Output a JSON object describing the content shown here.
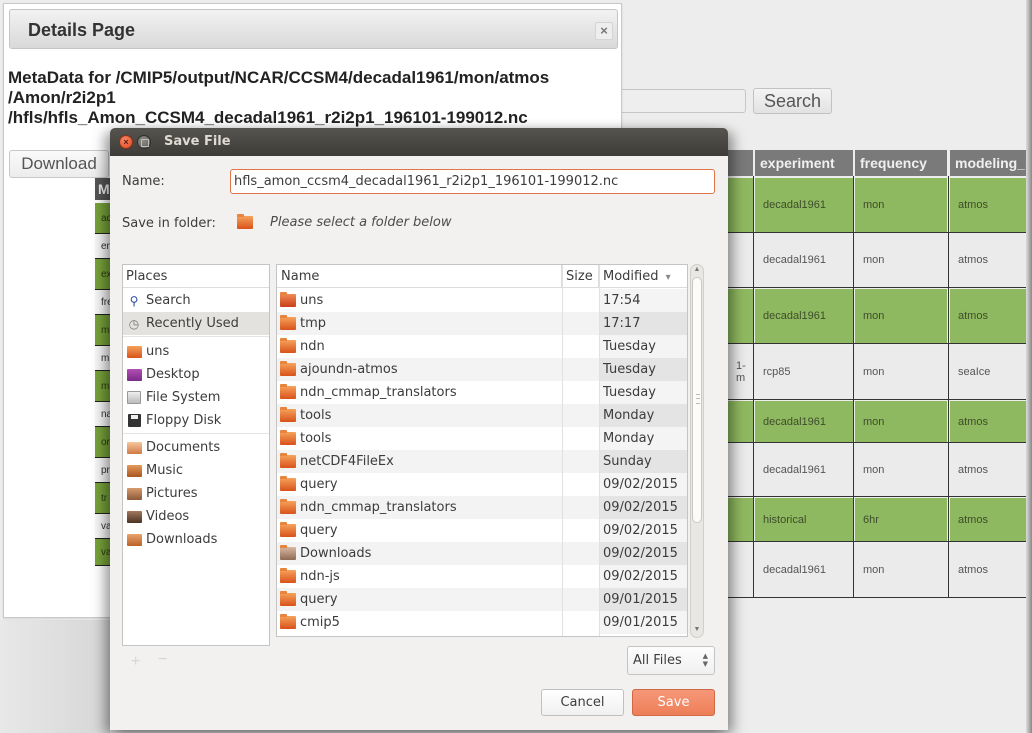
{
  "background_page": {
    "search": {
      "value": "",
      "button_label": "Search"
    },
    "results_table": {
      "columns": [
        "experiment",
        "frequency",
        "modeling_r"
      ],
      "rows": [
        {
          "cut_prefix": "",
          "experiment": "decadal1961",
          "frequency": "mon",
          "modeling_realm": "atmos",
          "highlight": true
        },
        {
          "cut_prefix": "",
          "experiment": "decadal1961",
          "frequency": "mon",
          "modeling_realm": "atmos",
          "highlight": false
        },
        {
          "cut_prefix": "",
          "experiment": "decadal1961",
          "frequency": "mon",
          "modeling_realm": "atmos",
          "highlight": true
        },
        {
          "cut_prefix": "1-m",
          "experiment": "rcp85",
          "frequency": "mon",
          "modeling_realm": "seaIce",
          "highlight": false
        },
        {
          "cut_prefix": "",
          "experiment": "decadal1961",
          "frequency": "mon",
          "modeling_realm": "atmos",
          "highlight": true
        },
        {
          "cut_prefix": "",
          "experiment": "decadal1961",
          "frequency": "mon",
          "modeling_realm": "atmos",
          "highlight": false
        },
        {
          "cut_prefix": "",
          "experiment": "historical",
          "frequency": "6hr",
          "modeling_realm": "atmos",
          "highlight": true
        },
        {
          "cut_prefix": "",
          "experiment": "decadal1961",
          "frequency": "mon",
          "modeling_realm": "atmos",
          "highlight": false
        }
      ]
    }
  },
  "details_page": {
    "title": "Details Page",
    "close_label": "×",
    "metadata_heading": "MetaData for /CMIP5/output/NCAR/CCSM4/decadal1961/mon/atmos /Amon/r2i2p1 /hfls/hfls_Amon_CCSM4_decadal1961_r2i2p1_196101-199012.nc",
    "metadata_lines": [
      "MetaData for /CMIP5/output/NCAR/CCSM4/decadal1961/mon/atmos",
      "/Amon/r2i2p1",
      "/hfls/hfls_Amon_CCSM4_decadal1961_r2i2p1_196101-199012.nc"
    ],
    "download_label": "Download",
    "side_table": {
      "header": "M",
      "cells": [
        "ac",
        "en",
        "ex",
        "fre",
        "m",
        "m",
        "m",
        "na",
        "or",
        "pr",
        "tr",
        "va",
        "va"
      ]
    }
  },
  "save_dialog": {
    "title": "Save File",
    "name_label": "Name:",
    "name_value": "hfls_amon_ccsm4_decadal1961_r2i2p1_196101-199012.nc",
    "folder_label": "Save in folder:",
    "folder_hint": "Please select a folder below",
    "places": {
      "header": "Places",
      "items": [
        {
          "label": "Search",
          "icon": "search-icon",
          "selected": false
        },
        {
          "label": "Recently Used",
          "icon": "clock-icon",
          "selected": true
        },
        {
          "label": "uns",
          "icon": "home-folder-icon",
          "selected": false
        },
        {
          "label": "Desktop",
          "icon": "desktop-icon",
          "selected": false
        },
        {
          "label": "File System",
          "icon": "drive-icon",
          "selected": false
        },
        {
          "label": "Floppy Disk",
          "icon": "floppy-icon",
          "selected": false
        },
        {
          "label": "Documents",
          "icon": "documents-folder-icon",
          "selected": false
        },
        {
          "label": "Music",
          "icon": "music-folder-icon",
          "selected": false
        },
        {
          "label": "Pictures",
          "icon": "pictures-folder-icon",
          "selected": false
        },
        {
          "label": "Videos",
          "icon": "videos-folder-icon",
          "selected": false
        },
        {
          "label": "Downloads",
          "icon": "downloads-folder-icon",
          "selected": false
        }
      ]
    },
    "files": {
      "columns": {
        "name": "Name",
        "size": "Size",
        "modified": "Modified",
        "sort_indicator": "▾"
      },
      "rows": [
        {
          "name": "uns",
          "icon": "home-folder-icon",
          "modified": "17:54"
        },
        {
          "name": "tmp",
          "icon": "folder-icon",
          "modified": "17:17"
        },
        {
          "name": "ndn",
          "icon": "folder-icon",
          "modified": "Tuesday"
        },
        {
          "name": "ajoundn-atmos",
          "icon": "folder-icon",
          "modified": "Tuesday"
        },
        {
          "name": "ndn_cmmap_translators",
          "icon": "folder-icon",
          "modified": "Tuesday"
        },
        {
          "name": "tools",
          "icon": "folder-icon",
          "modified": "Monday"
        },
        {
          "name": "tools",
          "icon": "folder-icon",
          "modified": "Monday"
        },
        {
          "name": "netCDF4FileEx",
          "icon": "folder-icon",
          "modified": "Sunday"
        },
        {
          "name": "query",
          "icon": "folder-icon",
          "modified": "09/02/2015"
        },
        {
          "name": "ndn_cmmap_translators",
          "icon": "folder-icon",
          "modified": "09/02/2015"
        },
        {
          "name": "query",
          "icon": "folder-icon",
          "modified": "09/02/2015"
        },
        {
          "name": "Downloads",
          "icon": "downloads-folder-icon",
          "modified": "09/02/2015"
        },
        {
          "name": "ndn-js",
          "icon": "folder-icon",
          "modified": "09/02/2015"
        },
        {
          "name": "query",
          "icon": "folder-icon",
          "modified": "09/01/2015"
        },
        {
          "name": "cmip5",
          "icon": "folder-icon",
          "modified": "09/01/2015"
        }
      ]
    },
    "add_bookmark_label": "+",
    "remove_bookmark_label": "−",
    "filter_value": "All Files",
    "cancel_label": "Cancel",
    "save_label": "Save",
    "colors": {
      "accent": "#ee7f57",
      "titlebar": "#3d3c38",
      "highlight_green": "#8fb960"
    }
  }
}
